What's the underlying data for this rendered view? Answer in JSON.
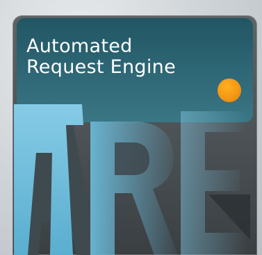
{
  "title_line1": "Automated",
  "title_line2": "Request Engine",
  "logo_letters": "ARE",
  "colors": {
    "teal_panel": "#2a6574",
    "letter_blue": "#6ab8d6",
    "orange_dot": "#f39513",
    "dark_panel": "#4a5054"
  }
}
